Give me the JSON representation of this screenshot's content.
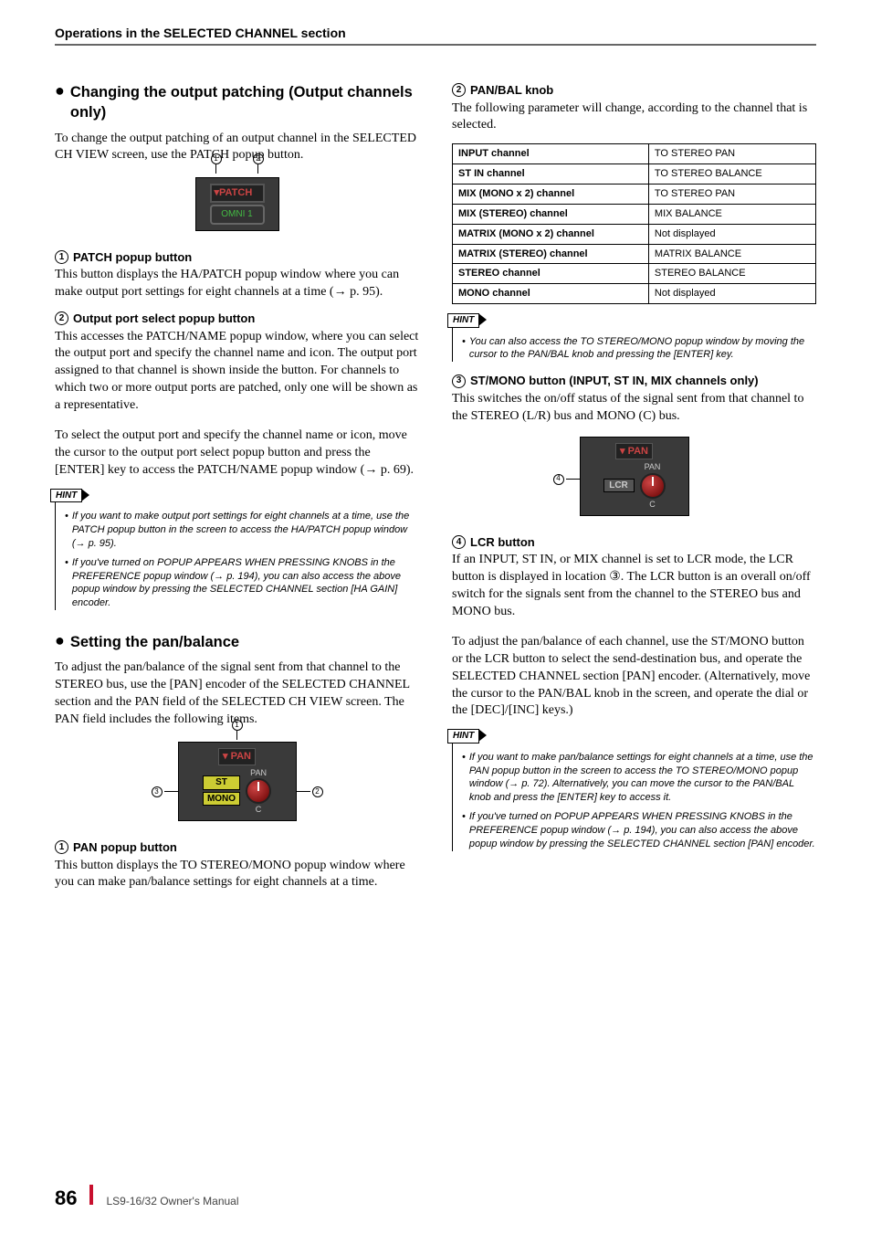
{
  "header": "Operations in the SELECTED CHANNEL section",
  "left": {
    "sec1": {
      "title": "Changing the output patching (Output channels only)",
      "p": "To change the output patching of an output channel in the SELECTED CH VIEW screen, use the PATCH popup button.",
      "fig": {
        "patch": "PATCH",
        "omni": "OMNI 1",
        "c1": "1",
        "c2": "2"
      },
      "item1": {
        "num": "1",
        "title": "PATCH popup button",
        "body": "This button displays the HA/PATCH popup window where you can make output port settings for eight channels at a time (→ p. 95)."
      },
      "item2": {
        "num": "2",
        "title": "Output port select popup button",
        "body": "This accesses the PATCH/NAME popup window, where you can select the output port and specify the channel name and icon. The output port assigned to that channel is shown inside the button. For channels to which two or more output ports are patched, only one will be shown as a representative."
      },
      "p2": "To select the output port and specify the channel name or icon, move the cursor to the output port select popup button and press the [ENTER] key to access the PATCH/NAME popup window (→ p. 69).",
      "hint": {
        "label": "HINT",
        "items": [
          "If you want to make output port settings for eight channels at a time, use the PATCH popup button in the screen to access the HA/PATCH popup window (→ p. 95).",
          "If you've turned on POPUP APPEARS WHEN PRESSING KNOBS in the PREFERENCE popup window (→ p. 194), you can also access the above popup window by pressing the SELECTED CHANNEL section [HA GAIN] encoder."
        ]
      }
    },
    "sec2": {
      "title": "Setting the pan/balance",
      "p": "To adjust the pan/balance of the signal sent from that channel to the STEREO bus, use the [PAN] encoder of the SELECTED CHANNEL section and the PAN field of the SELECTED CH VIEW screen. The PAN field includes the following items.",
      "fig": {
        "header": "PAN",
        "st": "ST",
        "mono": "MONO",
        "pan": "PAN",
        "c": "C",
        "c1": "1",
        "c2": "2",
        "c3": "3"
      },
      "item1": {
        "num": "1",
        "title": "PAN popup button",
        "body": "This button displays the TO STEREO/MONO popup window where you can make pan/balance settings for eight channels at a time."
      }
    }
  },
  "right": {
    "item2": {
      "num": "2",
      "title": "PAN/BAL knob",
      "body": "The following parameter will change, according to the channel that is selected."
    },
    "table": [
      [
        "INPUT channel",
        "TO STEREO PAN"
      ],
      [
        "ST IN channel",
        "TO STEREO BALANCE"
      ],
      [
        "MIX (MONO x 2) channel",
        "TO STEREO PAN"
      ],
      [
        "MIX (STEREO) channel",
        "MIX BALANCE"
      ],
      [
        "MATRIX (MONO x 2) channel",
        "Not displayed"
      ],
      [
        "MATRIX (STEREO) channel",
        "MATRIX BALANCE"
      ],
      [
        "STEREO channel",
        "STEREO BALANCE"
      ],
      [
        "MONO channel",
        "Not displayed"
      ]
    ],
    "hint1": {
      "label": "HINT",
      "items": [
        "You can also access the TO STEREO/MONO popup window by moving the cursor to the PAN/BAL knob and pressing the [ENTER] key."
      ]
    },
    "item3": {
      "num": "3",
      "title": "ST/MONO button (INPUT, ST IN, MIX channels only)",
      "body": "This switches the on/off status of the signal sent from that channel to the STEREO (L/R) bus and MONO (C) bus."
    },
    "fig": {
      "header": "PAN",
      "lcr": "LCR",
      "pan": "PAN",
      "c": "C",
      "c4": "4"
    },
    "item4": {
      "num": "4",
      "title": "LCR button",
      "body": "If an INPUT, ST IN, or MIX channel is set to LCR mode, the LCR button is displayed in location ③. The LCR button is an overall on/off switch for the signals sent from the channel to the STEREO bus and MONO bus."
    },
    "p3": "To adjust the pan/balance of each channel, use the ST/MONO button or the LCR button to select the send-destination bus, and operate the SELECTED CHANNEL section [PAN] encoder. (Alternatively, move the cursor to the PAN/BAL knob in the screen, and operate the dial or the [DEC]/[INC] keys.)",
    "hint2": {
      "label": "HINT",
      "items": [
        "If you want to make pan/balance settings for eight channels at a time, use the PAN popup button in the screen to access the TO STEREO/MONO popup window (→ p. 72). Alternatively, you can move the cursor to the PAN/BAL knob and press the [ENTER] key to access it.",
        "If you've turned on POPUP APPEARS WHEN PRESSING KNOBS in the PREFERENCE popup window (→ p. 194), you can also access the above popup window by pressing the SELECTED CHANNEL section [PAN] encoder."
      ]
    }
  },
  "footer": {
    "page": "86",
    "doc": "LS9-16/32  Owner's Manual"
  }
}
